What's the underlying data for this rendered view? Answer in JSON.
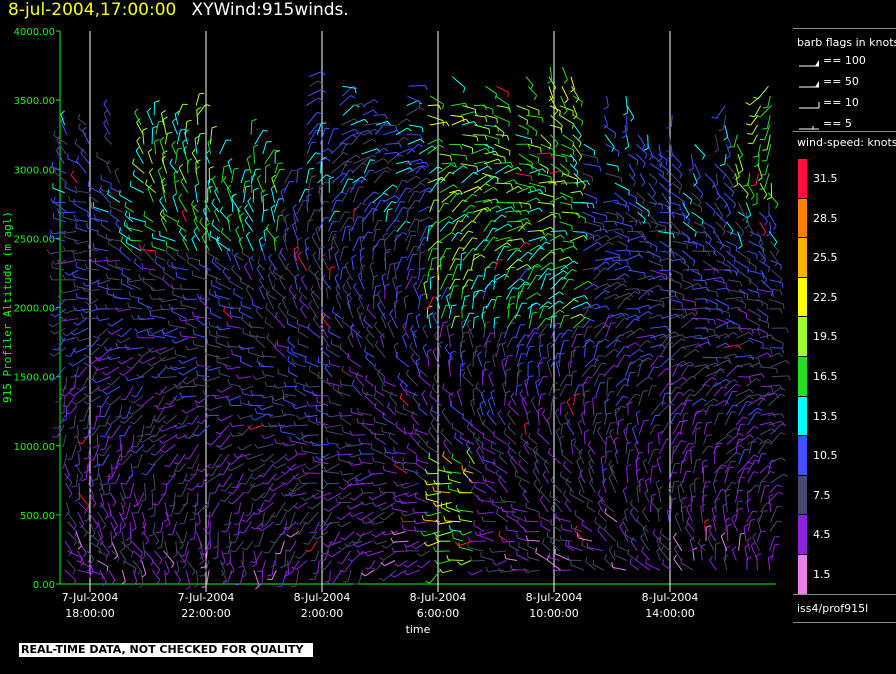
{
  "header": {
    "time_label": "8-jul-2004,17:00:00",
    "product_label": "XYWind:915winds."
  },
  "chart_data": {
    "type": "wind barb time-height plot",
    "ylabel": "915 Profiler Altitude (m agl)",
    "xlabel": "time",
    "ylim": [
      0,
      4000
    ],
    "yticks": [
      "0.00",
      "500.00",
      "1000.00",
      "1500.00",
      "2000.00",
      "2500.00",
      "3000.00",
      "3500.00",
      "4000.00"
    ],
    "xticks": [
      {
        "date": "7-Jul-2004",
        "time": "18:00:00"
      },
      {
        "date": "7-Jul-2004",
        "time": "22:00:00"
      },
      {
        "date": "8-Jul-2004",
        "time": "2:00:00"
      },
      {
        "date": "8-Jul-2004",
        "time": "6:00:00"
      },
      {
        "date": "8-Jul-2004",
        "time": "10:00:00"
      },
      {
        "date": "8-Jul-2004",
        "time": "14:00:00"
      }
    ],
    "grid": "vertical lines at major time ticks",
    "units": "knots"
  },
  "legend": {
    "flags_title": "barb flags in knots",
    "flags": [
      "== 100",
      "== 50",
      "== 10",
      "== 5"
    ],
    "speed_title": "wind-speed: knots",
    "speed_bins": [
      {
        "label": "31.5",
        "color": "#ff1040"
      },
      {
        "label": "28.5",
        "color": "#ff8000"
      },
      {
        "label": "25.5",
        "color": "#ffb000"
      },
      {
        "label": "22.5",
        "color": "#ffff00"
      },
      {
        "label": "19.5",
        "color": "#a0ff30"
      },
      {
        "label": "16.5",
        "color": "#20e020"
      },
      {
        "label": "13.5",
        "color": "#00ffff"
      },
      {
        "label": "10.5",
        "color": "#4050ff"
      },
      {
        "label": "7.5",
        "color": "#484870"
      },
      {
        "label": "4.5",
        "color": "#9020e0"
      },
      {
        "label": "1.5",
        "color": "#e880e8"
      }
    ],
    "footer": "iss4/prof915l"
  },
  "notice": "REAL-TIME DATA, NOT CHECKED FOR QUALITY",
  "colors": {
    "axis": "#00ff00",
    "title_time": "#ffff00",
    "gridline": "#ffffff",
    "background": "#000000"
  }
}
